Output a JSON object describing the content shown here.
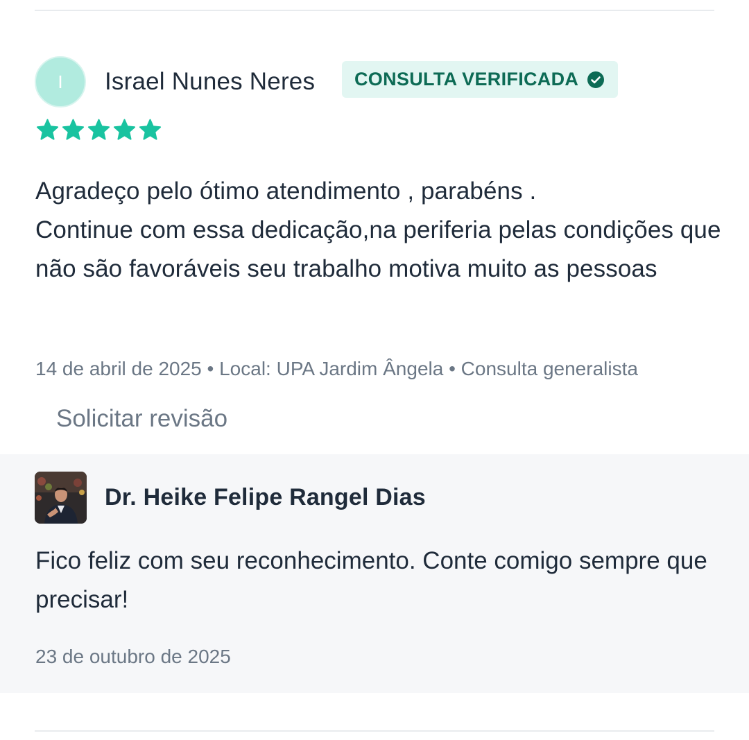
{
  "review": {
    "avatar_initial": "I",
    "reviewer_name": "Israel Nunes Neres",
    "verified_badge": "CONSULTA VERIFICADA",
    "rating": 5,
    "rating_max": 5,
    "text_lines": [
      "Agradeço pelo ótimo atendimento , parabéns .",
      "Continue com essa dedicação,na periferia pelas condições que não são favoráveis seu trabalho motiva muito as pessoas"
    ],
    "meta": "14 de abril de 2025 • Local: UPA Jardim Ângela • Consulta generalista",
    "request_review_label": "Solicitar revisão"
  },
  "reply": {
    "doctor_name": "Dr. Heike Felipe Rangel Dias",
    "text": "Fico feliz com seu reconhecimento. Conte comigo sempre que precisar!",
    "date": "23 de outubro de 2025"
  },
  "colors": {
    "star": "#19c3a0",
    "badge_bg": "#e2f6f2",
    "badge_text": "#0d6b55",
    "avatar_bg": "#b1ebdf",
    "reply_bg": "#f6f7f9",
    "muted_text": "#6b7785"
  },
  "icons": {
    "badge": "check-circle-icon",
    "rating": "star-icon"
  }
}
